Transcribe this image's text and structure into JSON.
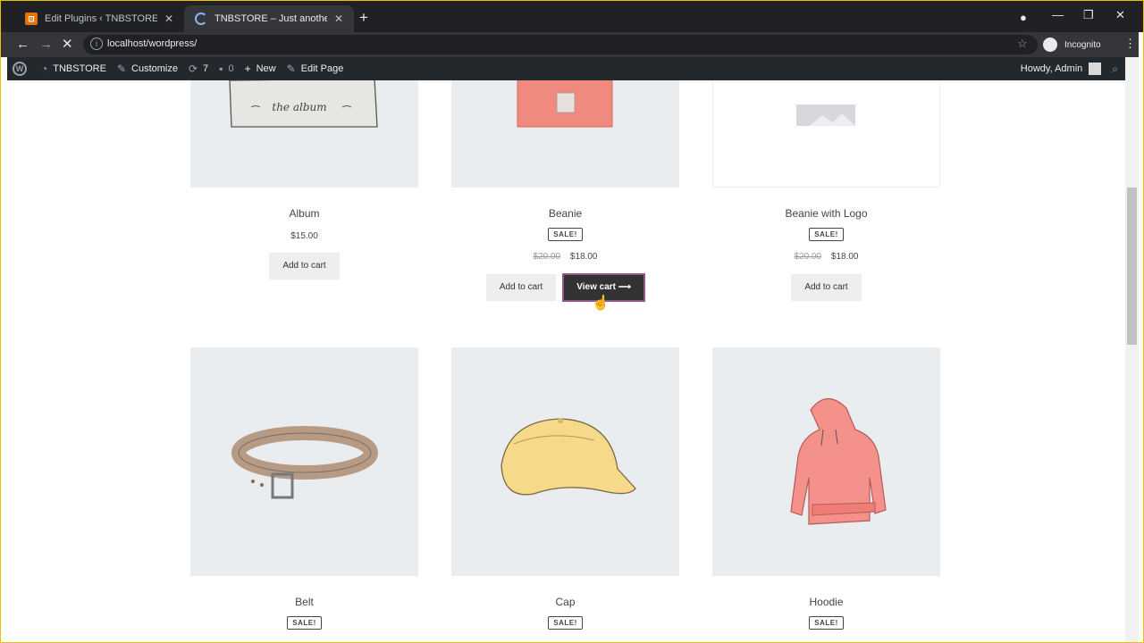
{
  "browser": {
    "tabs": [
      {
        "title": "Edit Plugins ‹ TNBSTORE — Word",
        "active": false
      },
      {
        "title": "TNBSTORE – Just another WordP",
        "active": true
      }
    ],
    "new_tab_label": "+",
    "url": "localhost/wordpress/",
    "profile_label": "Incognito"
  },
  "admin_bar": {
    "site_name": "TNBSTORE",
    "customize": "Customize",
    "updates_count": "7",
    "comments_count": "0",
    "new_label": "New",
    "edit_page": "Edit Page",
    "greeting": "Howdy, Admin"
  },
  "products": [
    {
      "name": "Album",
      "sale_badge": "",
      "price_old": "",
      "price": "$15.00",
      "add_to_cart": "Add to cart",
      "image": "album-icon"
    },
    {
      "name": "Beanie",
      "sale_badge": "SALE!",
      "price_old": "$20.00",
      "price": "$18.00",
      "add_to_cart": "Add to cart",
      "view_cart": "View cart",
      "image": "beanie-icon"
    },
    {
      "name": "Beanie with Logo",
      "sale_badge": "SALE!",
      "price_old": "$20.00",
      "price": "$18.00",
      "add_to_cart": "Add to cart",
      "image": "placeholder-image-icon"
    },
    {
      "name": "Belt",
      "sale_badge": "SALE!",
      "image": "belt-icon"
    },
    {
      "name": "Cap",
      "sale_badge": "SALE!",
      "image": "cap-icon"
    },
    {
      "name": "Hoodie",
      "sale_badge": "SALE!",
      "image": "hoodie-icon"
    }
  ],
  "album_text": "the album",
  "colors": {
    "admin_bar": "#23282d",
    "product_bg": "#eaedf0",
    "view_cart_bg": "#333333",
    "accent": "#96588a"
  }
}
